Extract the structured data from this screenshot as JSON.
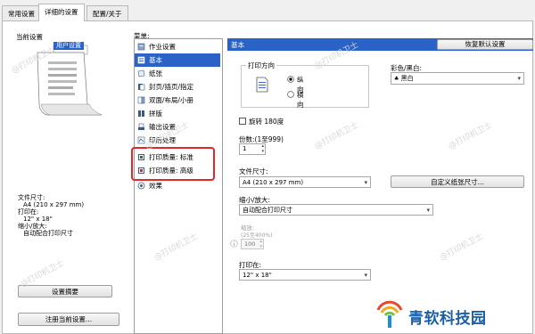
{
  "tabs": [
    "常用设置",
    "详细的设置",
    "配置/关于"
  ],
  "left_panel": {
    "title": "当前设置",
    "preview_highlight": "用户设置",
    "info": [
      {
        "label": "文件尺寸:",
        "value": "A4 (210 x 297 mm)"
      },
      {
        "label": "打印在:",
        "value": "12\" x 18\""
      },
      {
        "label": "缩小/放大:",
        "value": "自动配合打印尺寸"
      }
    ],
    "summary_button": "设置摘要",
    "register_button": "注册当前设置..."
  },
  "menu": {
    "title": "菜单:",
    "items": [
      {
        "label": "作业设置",
        "icon": "job-icon"
      },
      {
        "label": "基本",
        "icon": "basic-icon",
        "selected": true
      },
      {
        "label": "纸张",
        "icon": "paper-icon"
      },
      {
        "label": "封页/插页/指定",
        "icon": "cover-icon"
      },
      {
        "label": "双面/布局/小册",
        "icon": "duplex-icon"
      },
      {
        "label": "拼版",
        "icon": "imposition-icon"
      },
      {
        "label": "输出设置",
        "icon": "output-icon"
      },
      {
        "label": "印后处理",
        "icon": "finishing-icon"
      },
      {
        "label": "打印质量: 标准",
        "icon": "quality-icon"
      },
      {
        "label": "打印质量: 高级",
        "icon": "quality-advanced-icon"
      },
      {
        "label": "效果",
        "icon": "effect-icon"
      }
    ]
  },
  "main": {
    "header": "基本",
    "restore_button": "恢复默认设置",
    "orientation": {
      "title": "打印方向",
      "portrait": "纵向",
      "landscape": "横向"
    },
    "color": {
      "label": "彩色/黑白:",
      "value": "黑白"
    },
    "rotate_label": "旋转 180度",
    "copies": {
      "label": "份数:(1至999)",
      "value": "1"
    },
    "paper_size": {
      "label": "文件尺寸:",
      "value": "A4 (210 x 297 mm)"
    },
    "custom_size_button": "自定义纸张尺寸...",
    "scale": {
      "label": "缩小/放大:",
      "value": "自动配合打印尺寸"
    },
    "zoom": {
      "label": "缩放:",
      "range": "(25至400%)",
      "value": "100"
    },
    "print_on": {
      "label": "打印在:",
      "value": "12\" x 18\""
    }
  },
  "watermark": "@打印机卫士",
  "brand": {
    "text": "青软科技园",
    "color": "#1a5fa8"
  },
  "colors": {
    "selection": "#2a62c8",
    "highlight_box": "#e12828"
  }
}
